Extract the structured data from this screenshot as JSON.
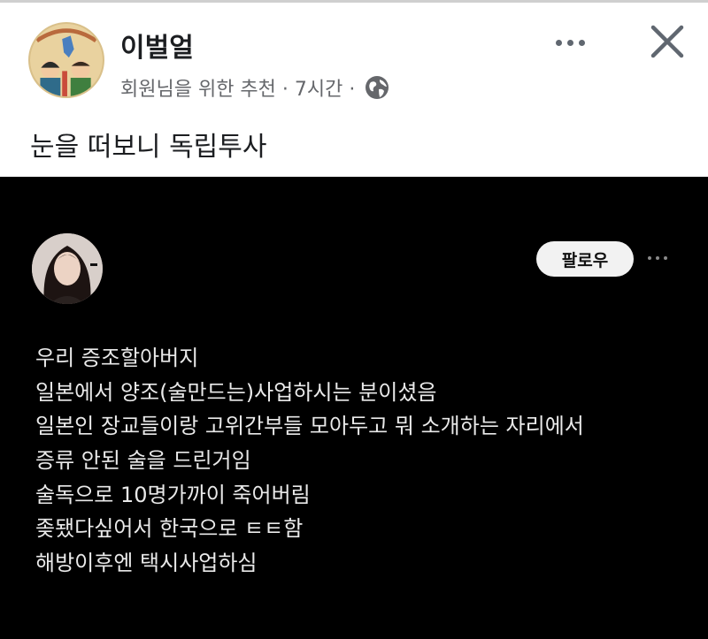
{
  "post": {
    "author": "이벌얼",
    "meta": "회원님을 위한 추천 · 7시간 ·",
    "text": "눈을 떠보니 독립투사"
  },
  "embedded": {
    "follow_label": "팔로우",
    "lines": [
      "우리 증조할아버지",
      "일본에서 양조(술만드는)사업하시는 분이셨음",
      "일본인 장교들이랑 고위간부들 모아두고 뭐 소개하는 자리에서",
      "증류 안된 술을 드린거임",
      "술독으로 10명가까이 죽어버림",
      "좆됐다싶어서 한국으로 ㅌㅌ함",
      "해방이후엔 택시사업하심"
    ]
  },
  "icons": {
    "more": "more-horizontal-icon",
    "close": "close-icon",
    "audience": "globe-icon",
    "dark_more": "more-horizontal-icon"
  },
  "colors": {
    "author_text": "#1c1e21",
    "meta_text": "#65676b",
    "embedded_bg": "#000000",
    "embedded_text": "#e9e9e9",
    "follow_bg": "#f2f2f2"
  }
}
